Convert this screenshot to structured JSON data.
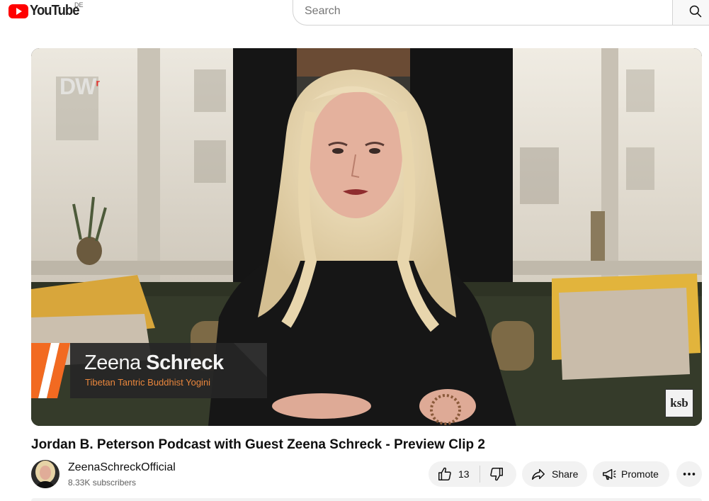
{
  "header": {
    "logo_text": "YouTube",
    "region": "DE",
    "search_placeholder": "Search",
    "search_icon": "search-icon"
  },
  "video": {
    "overlay_logo": "DW",
    "lower_third": {
      "first_name": "Zeena",
      "last_name": "Schreck",
      "role": "Tibetan Tantric Buddhist Yogini"
    },
    "corner_logo": "ksb"
  },
  "title": "Jordan B. Peterson Podcast with Guest Zeena Schreck - Preview Clip 2",
  "channel": {
    "name": "ZeenaSchreckOfficial",
    "subscribers": "8.33K subscribers"
  },
  "actions": {
    "like_count": "13",
    "share_label": "Share",
    "promote_label": "Promote"
  },
  "colors": {
    "brand_red": "#ff0000",
    "pill_bg": "#f2f2f2",
    "lower_third_accent": "#f26a21"
  }
}
